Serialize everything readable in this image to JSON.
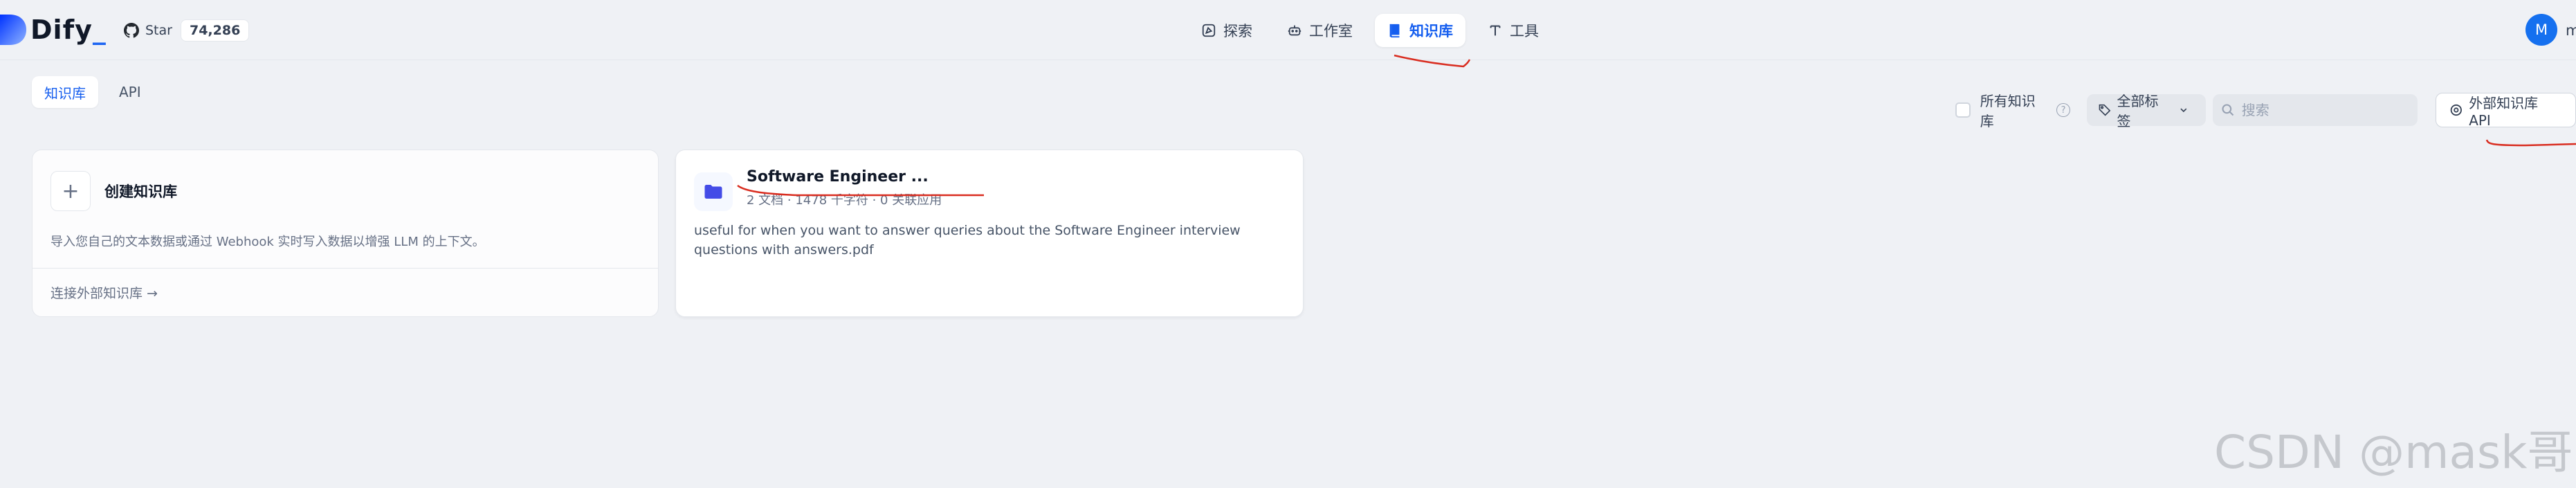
{
  "app": {
    "name": "Dify",
    "name_suffix": "_"
  },
  "github": {
    "label": "Star",
    "count": "74,286"
  },
  "nav": [
    {
      "label": "探索",
      "icon": "explore-icon"
    },
    {
      "label": "工作室",
      "icon": "robot-icon"
    },
    {
      "label": "知识库",
      "icon": "book-icon",
      "active": true
    },
    {
      "label": "工具",
      "icon": "tool-icon"
    }
  ],
  "user": {
    "avatar_letter": "M",
    "name_fragment": "m"
  },
  "subtabs": [
    {
      "label": "知识库",
      "active": true
    },
    {
      "label": "API",
      "active": false
    }
  ],
  "filters": {
    "all_datasets_label": "所有知识库",
    "help_symbol": "?",
    "tag_label": "全部标签",
    "search_placeholder": "搜索",
    "external_api_label": "外部知识库 API"
  },
  "create_card": {
    "plus": "+",
    "title": "创建知识库",
    "description": "导入您自己的文本数据或通过 Webhook 实时写入数据以增强 LLM 的上下文。",
    "connect_label": "连接外部知识库 →"
  },
  "dataset_card": {
    "title": "Software Engineer ...",
    "meta": "2 文档 · 1478 千字符 · 0 关联应用",
    "description": "useful for when you want to answer queries about the Software Engineer interview questions with answers.pdf"
  },
  "watermark": "CSDN @mask哥",
  "colors": {
    "accent": "#155eef",
    "annotation": "#d92d20",
    "background": "#eff1f5"
  }
}
